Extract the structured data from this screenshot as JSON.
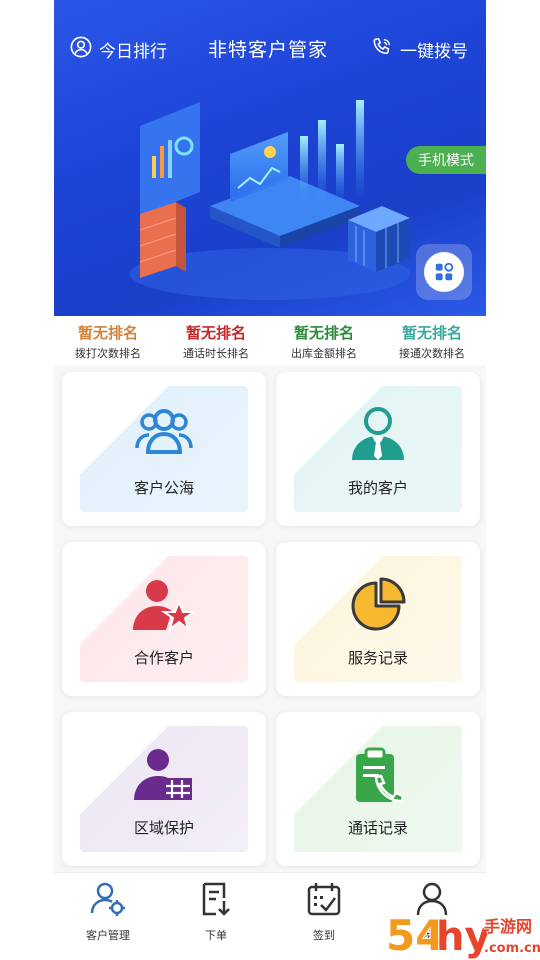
{
  "header": {
    "left_label": "今日排行",
    "title": "非特客户管家",
    "right_label": "一键拨号",
    "mode_tag": "手机模式"
  },
  "ranks": [
    {
      "value": "暂无排名",
      "label": "拨打次数排名",
      "color": "#d4813a"
    },
    {
      "value": "暂无排名",
      "label": "通话时长排名",
      "color": "#c62828"
    },
    {
      "value": "暂无排名",
      "label": "出库金额排名",
      "color": "#2e8b3a"
    },
    {
      "value": "暂无排名",
      "label": "接通次数排名",
      "color": "#3aa89c"
    }
  ],
  "cards": [
    {
      "label": "客户公海",
      "icon": "group-icon",
      "tint": "#e8f3fc"
    },
    {
      "label": "我的客户",
      "icon": "person-tie-icon",
      "tint": "#e9f6f6"
    },
    {
      "label": "合作客户",
      "icon": "person-star-icon",
      "tint": "#fdecee"
    },
    {
      "label": "服务记录",
      "icon": "pie-chart-icon",
      "tint": "#fdf8e6"
    },
    {
      "label": "区域保护",
      "icon": "person-lock-icon",
      "tint": "#f1edf6"
    },
    {
      "label": "通话记录",
      "icon": "clipboard-phone-icon",
      "tint": "#eef7ee"
    }
  ],
  "nav": [
    {
      "label": "客户管理",
      "icon": "user-gear-icon"
    },
    {
      "label": "下单",
      "icon": "order-icon"
    },
    {
      "label": "签到",
      "icon": "calendar-check-icon"
    },
    {
      "label": "我的",
      "icon": "person-icon"
    }
  ],
  "watermark": "54hy手游网",
  "colors": {
    "banner": "#1e44d6",
    "accent_green": "#4caf50",
    "group_blue": "#2f86d6",
    "tie_teal": "#1f9e8e",
    "star_red": "#d93a4a",
    "pie_yellow": "#f5b82e",
    "lock_purple": "#6b2a8e",
    "phone_green": "#3aa64a"
  }
}
